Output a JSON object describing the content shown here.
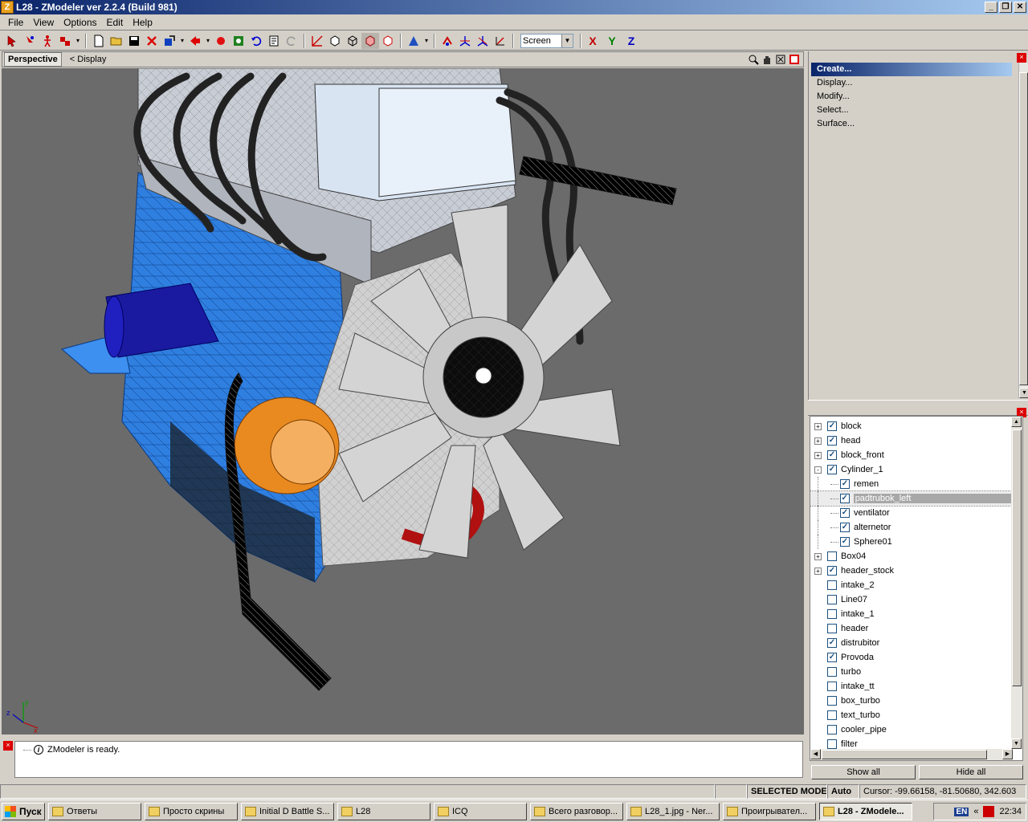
{
  "window": {
    "title": "L28 - ZModeler ver 2.2.4 (Build 981)",
    "app_icon_letter": "Z",
    "buttons": {
      "minimize": "_",
      "restore": "❐",
      "close": "✕"
    }
  },
  "menu": [
    "File",
    "View",
    "Options",
    "Edit",
    "Help"
  ],
  "toolbar": {
    "coord_combo": "Screen",
    "axes": {
      "x": "X",
      "y": "Y",
      "z": "Z"
    },
    "axis_colors": {
      "x": "#c00000",
      "y": "#008000",
      "z": "#0000c0"
    }
  },
  "viewport": {
    "tab_label": "Perspective",
    "sub_label": "<  Display",
    "bg_color": "#6b6b6b",
    "gizmo": {
      "x": "x",
      "y": "y",
      "z": "z"
    }
  },
  "command_panel": {
    "items": [
      "Create...",
      "Display...",
      "Modify...",
      "Select...",
      "Surface..."
    ],
    "active_index": 0
  },
  "tree": {
    "rows": [
      {
        "label": "block",
        "checked": true,
        "expander": "+",
        "level": 0
      },
      {
        "label": "head",
        "checked": true,
        "expander": "+",
        "level": 0
      },
      {
        "label": "block_front",
        "checked": true,
        "expander": "+",
        "level": 0
      },
      {
        "label": "Cylinder_1",
        "checked": true,
        "expander": "-",
        "level": 0
      },
      {
        "label": "remen",
        "checked": true,
        "expander": "",
        "level": 1
      },
      {
        "label": "padtrubok_left",
        "checked": true,
        "expander": "",
        "level": 1,
        "selected": true
      },
      {
        "label": "ventilator",
        "checked": true,
        "expander": "",
        "level": 1
      },
      {
        "label": "alternetor",
        "checked": true,
        "expander": "",
        "level": 1
      },
      {
        "label": "Sphere01",
        "checked": true,
        "expander": "",
        "level": 1
      },
      {
        "label": "Box04",
        "checked": false,
        "expander": "+",
        "level": 0
      },
      {
        "label": "header_stock",
        "checked": true,
        "expander": "+",
        "level": 0
      },
      {
        "label": "intake_2",
        "checked": false,
        "expander": "",
        "level": 0
      },
      {
        "label": "Line07",
        "checked": false,
        "expander": "",
        "level": 0
      },
      {
        "label": "intake_1",
        "checked": false,
        "expander": "",
        "level": 0
      },
      {
        "label": "header",
        "checked": false,
        "expander": "",
        "level": 0
      },
      {
        "label": "distrubitor",
        "checked": true,
        "expander": "",
        "level": 0
      },
      {
        "label": "Provoda",
        "checked": true,
        "expander": "",
        "level": 0
      },
      {
        "label": "turbo",
        "checked": false,
        "expander": "",
        "level": 0
      },
      {
        "label": "intake_tt",
        "checked": false,
        "expander": "",
        "level": 0
      },
      {
        "label": "box_turbo",
        "checked": false,
        "expander": "",
        "level": 0
      },
      {
        "label": "text_turbo",
        "checked": false,
        "expander": "",
        "level": 0
      },
      {
        "label": "cooler_pipe",
        "checked": false,
        "expander": "",
        "level": 0
      },
      {
        "label": "filter",
        "checked": false,
        "expander": "",
        "level": 0
      }
    ],
    "show_all": "Show all",
    "hide_all": "Hide all"
  },
  "log": {
    "message": "ZModeler is ready."
  },
  "status": {
    "mode": "SELECTED MODE",
    "auto": "Auto",
    "cursor": "Cursor: -99.66158, -81.50680, 342.603"
  },
  "taskbar": {
    "start": "Пуск",
    "tasks": [
      {
        "label": "Ответы",
        "active": false
      },
      {
        "label": "Просто скрины",
        "active": false
      },
      {
        "label": "Initial D Battle S...",
        "active": false
      },
      {
        "label": "L28",
        "active": false
      },
      {
        "label": "ICQ",
        "active": false
      },
      {
        "label": "Всего разговор...",
        "active": false
      },
      {
        "label": "L28_1.jpg - Ner...",
        "active": false
      },
      {
        "label": "Проигрывател...",
        "active": false
      },
      {
        "label": "L28 - ZModele...",
        "active": true
      }
    ],
    "lang": "EN",
    "chevron": "«",
    "clock": "22:34"
  },
  "colors": {
    "title_start": "#0a246a",
    "title_end": "#a6caf0",
    "engine_block": "#2f7fe0",
    "filter": "#1a1aa0",
    "alternator": "#e88a20",
    "belt": "#b01010"
  }
}
